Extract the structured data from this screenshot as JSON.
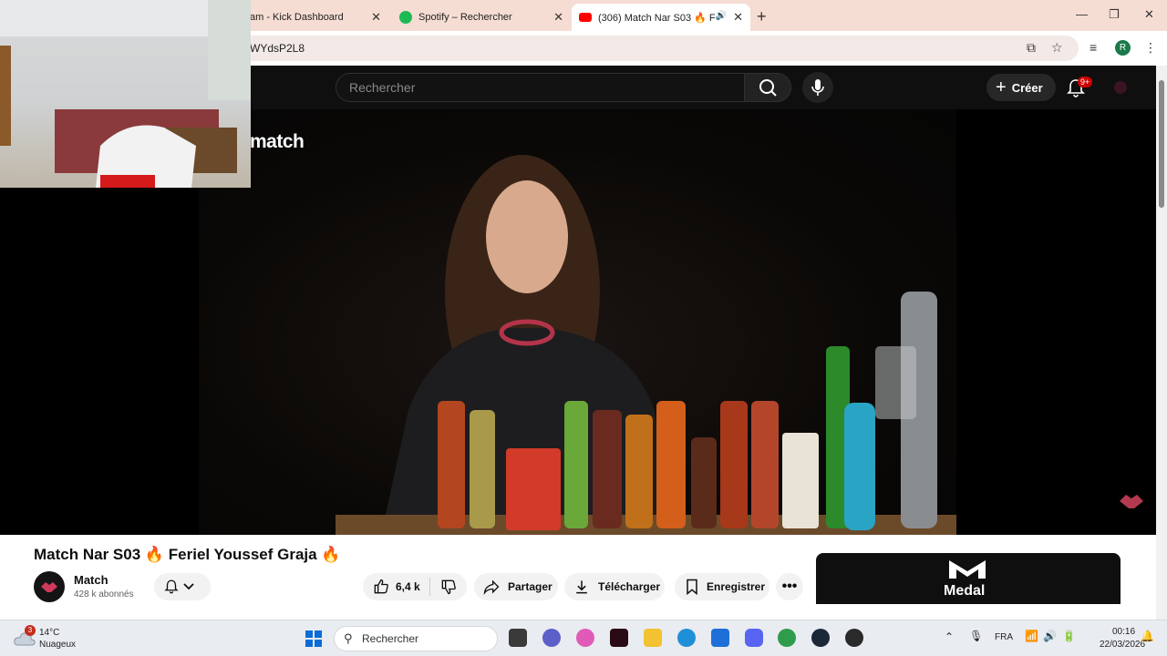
{
  "browser": {
    "tabs": [
      {
        "title": "am - Kick Dashboard",
        "icon": "kick-icon",
        "color": "#53fc18"
      },
      {
        "title": "Spotify – Rechercher",
        "icon": "spotify-icon",
        "color": "#1db954"
      },
      {
        "title": "(306) Match Nar S03 🔥 Fe",
        "icon": "youtube-icon",
        "color": "#ff0000"
      }
    ],
    "url": "WYdsP2L8",
    "profile_initial": "R"
  },
  "youtube": {
    "search_placeholder": "Rechercher",
    "create_label": "Créer",
    "notif_badge": "9+",
    "watermark": "match",
    "video": {
      "title": "Match Nar S03 🔥 Feriel Youssef Graja 🔥",
      "channel": "Match",
      "subscribers": "428 k abonnés",
      "likes": "6,4 k",
      "share_label": "Partager",
      "download_label": "Télécharger",
      "save_label": "Enregistrer"
    },
    "sidebar_card": {
      "logo_text": "Medal"
    }
  },
  "taskbar": {
    "weather_temp": "14°C",
    "weather_desc": "Nuageux",
    "weather_badge": "3",
    "search_label": "Rechercher",
    "language": "FRA",
    "time": "00:16",
    "date": "22/03/2026"
  },
  "colors": {
    "youtube_red": "#ff0000",
    "accent_badge": "#cc0000",
    "tabbar_bg": "#f6ddd3"
  }
}
